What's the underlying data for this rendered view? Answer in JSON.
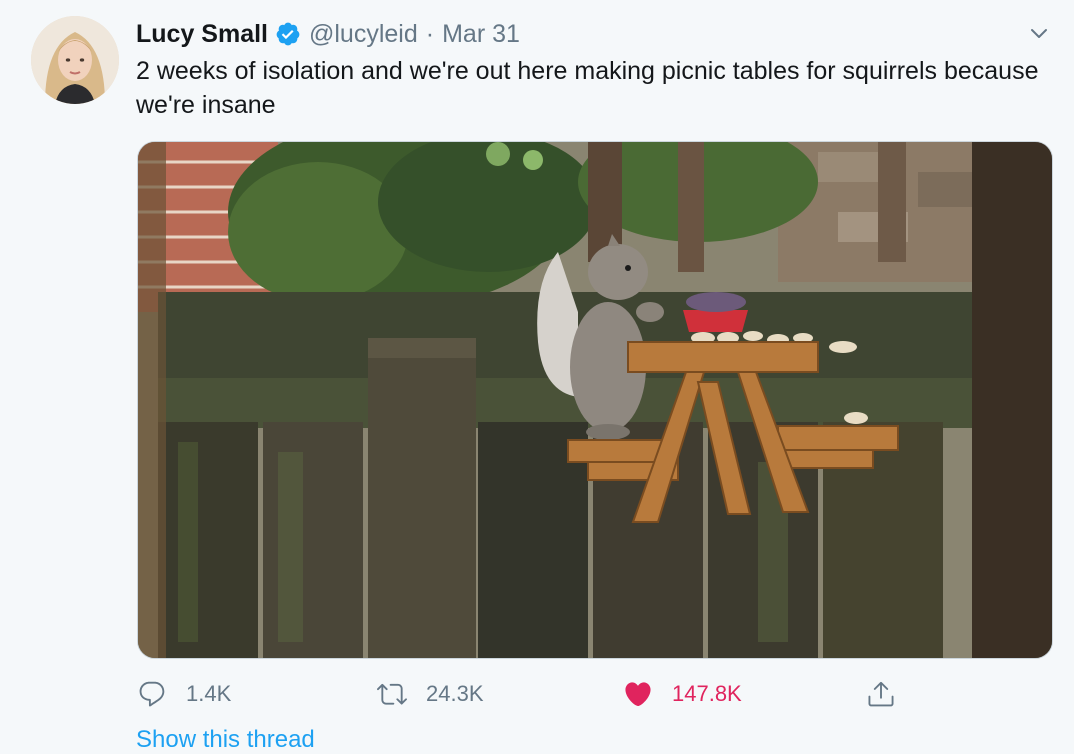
{
  "tweet": {
    "author_name": "Lucy Small",
    "handle": "@lucyleid",
    "separator": "·",
    "date": "Mar 31",
    "text": "2 weeks of isolation and we're out here making picnic tables for squirrels because we're insane",
    "verified": true,
    "verified_color": "#1da1f2"
  },
  "actions": {
    "reply": {
      "icon": "reply-icon",
      "count": "1.4K"
    },
    "retweet": {
      "icon": "retweet-icon",
      "count": "24.3K"
    },
    "like": {
      "icon": "heart-icon",
      "count": "147.8K",
      "active": true,
      "color": "#e0245e"
    },
    "share": {
      "icon": "share-icon"
    }
  },
  "thread_link": "Show this thread"
}
